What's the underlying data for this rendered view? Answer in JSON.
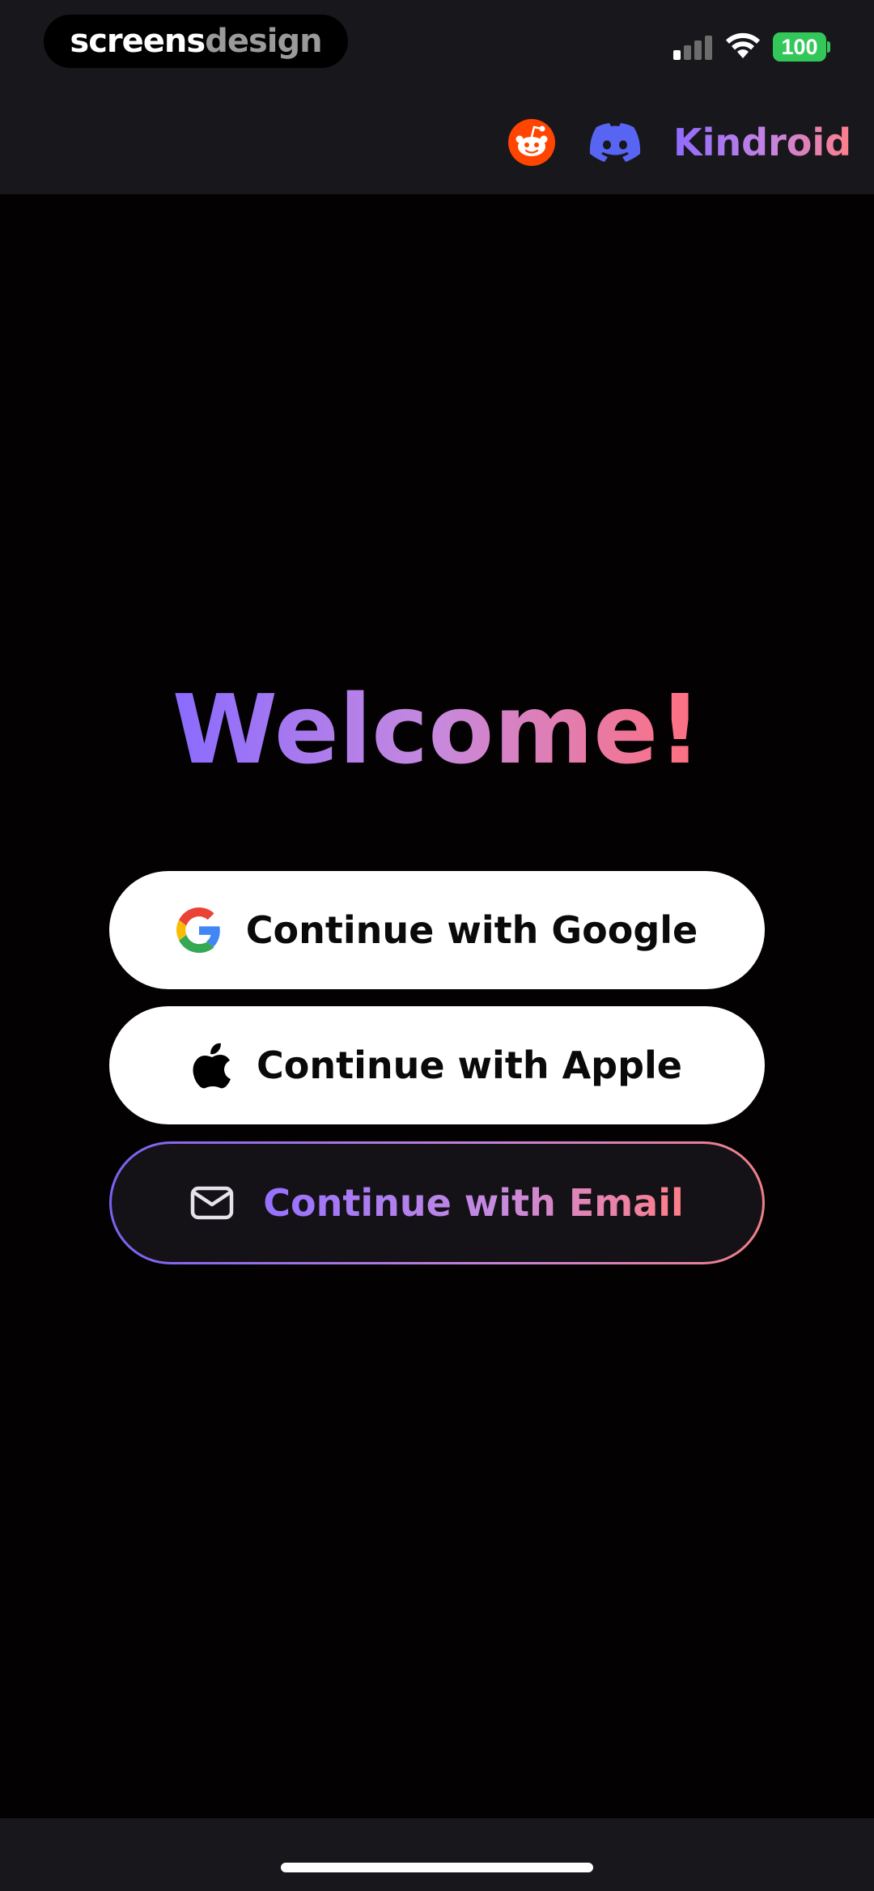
{
  "watermark": {
    "part_a": "screens",
    "part_b": "design"
  },
  "status_bar": {
    "battery_level": "100",
    "signal_icon": "cellular-signal-icon",
    "wifi_icon": "wifi-icon",
    "battery_color": "#33c759"
  },
  "header": {
    "reddit_icon": "reddit-icon",
    "discord_icon": "discord-icon",
    "brand_name": "Kindroid",
    "reddit_color": "#ff4500",
    "discord_color": "#5865f2"
  },
  "main": {
    "title": "Welcome!",
    "gradient_start": "#8a6bff",
    "gradient_end": "#ff6f7e"
  },
  "auth": {
    "google": {
      "label": "Continue with Google",
      "icon": "google-logo-icon"
    },
    "apple": {
      "label": "Continue with Apple",
      "icon": "apple-logo-icon"
    },
    "email": {
      "label": "Continue with Email",
      "icon": "mail-icon"
    }
  }
}
